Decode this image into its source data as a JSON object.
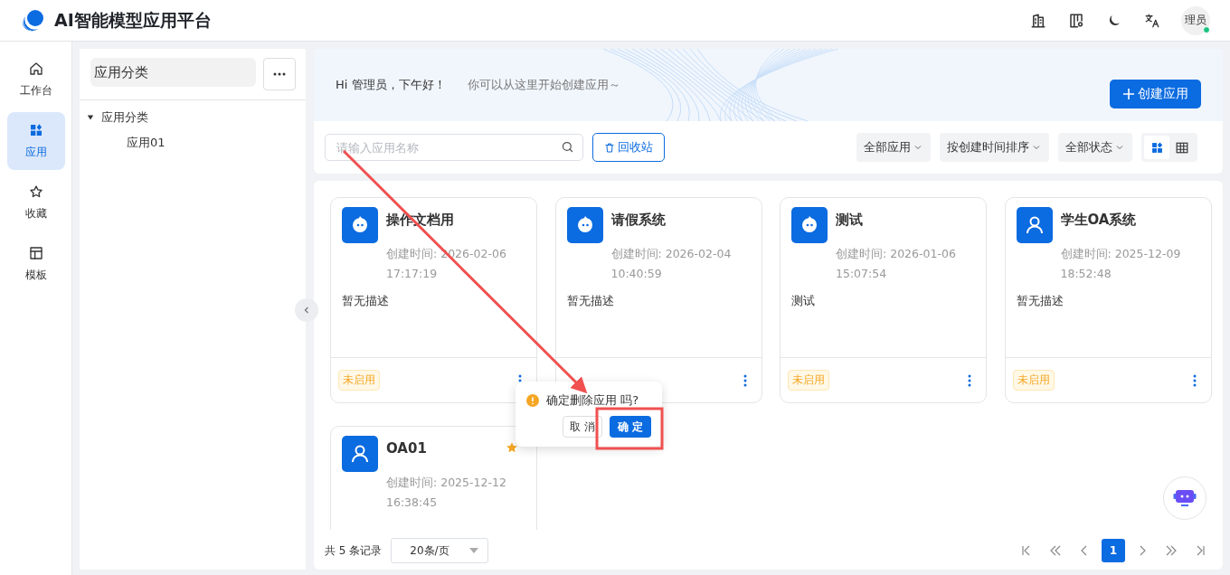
{
  "header": {
    "title": "AI智能模型应用平台",
    "avatar": "理员",
    "online": true
  },
  "nav": [
    {
      "label": "工作台",
      "kind": "home",
      "selected": false
    },
    {
      "label": "应用",
      "kind": "apps",
      "selected": true
    },
    {
      "label": "收藏",
      "kind": "star",
      "selected": false
    },
    {
      "label": "模板",
      "kind": "template",
      "selected": false
    }
  ],
  "category_panel": {
    "title": "应用分类",
    "tree": [
      {
        "label": "应用分类",
        "expanded": true,
        "children": [
          {
            "label": "应用01"
          }
        ]
      }
    ]
  },
  "banner": {
    "greeting": "Hi 管理员，下午好！",
    "subtitle": "你可以从这里开始创建应用～",
    "create_button": "创建应用"
  },
  "toolbar": {
    "search_placeholder": "请输入应用名称",
    "recycle_button": "回收站",
    "filters": [
      "全部应用",
      "按创建时间排序",
      "全部状态"
    ],
    "views": [
      {
        "kind": "grid",
        "selected": true
      },
      {
        "kind": "table",
        "selected": false
      }
    ]
  },
  "cards": [
    {
      "title": "操作文档用",
      "kind": "robot",
      "created": "创建时间: 2026-02-06 17:17:19",
      "description": "暂无描述",
      "status": "未启用",
      "favorite": false
    },
    {
      "title": "请假系统",
      "kind": "robot",
      "created": "创建时间: 2026-02-04 10:40:59",
      "description": "暂无描述",
      "favorite": false
    },
    {
      "title": "测试",
      "kind": "robot",
      "created": "创建时间: 2026-01-06 15:07:54",
      "description": "测试",
      "status": "未启用",
      "favorite": false
    },
    {
      "title": "学生OA系统",
      "kind": "user",
      "created": "创建时间: 2025-12-09 18:52:48",
      "description": "暂无描述",
      "status": "未启用",
      "favorite": false
    },
    {
      "title": "OA01",
      "kind": "user",
      "created": "创建时间: 2025-12-12 16:38:45",
      "favorite": true
    }
  ],
  "popconfirm": {
    "message": "确定删除应用 吗?",
    "cancel": "取 消",
    "confirm": "确 定"
  },
  "pagination": {
    "total": "共 5 条记录",
    "page_size": "20条/页",
    "pages": [
      {
        "label": "1",
        "selected": true
      }
    ]
  }
}
